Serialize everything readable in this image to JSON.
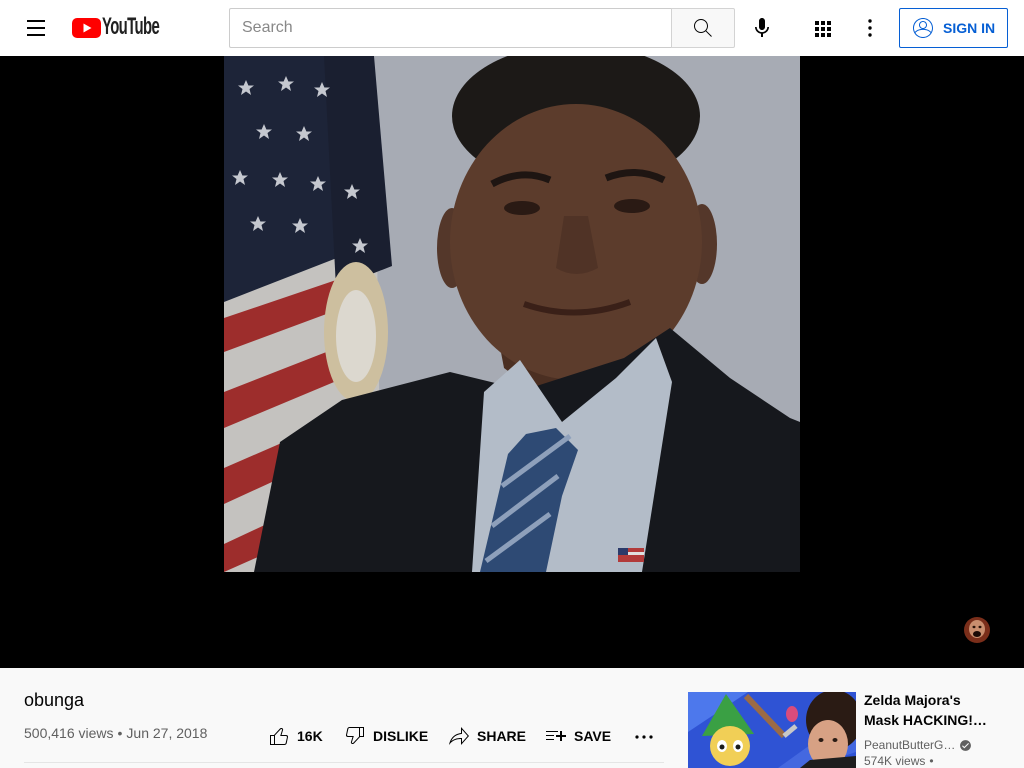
{
  "header": {
    "menu_icon": "hamburger-menu-icon",
    "logo_icon": "youtube-play-icon",
    "logo_text": "YouTube",
    "search_placeholder": "Search",
    "search_icon": "search-icon",
    "mic_icon": "microphone-icon",
    "apps_icon": "apps-grid-icon",
    "more_icon": "more-vertical-icon",
    "sign_in_icon": "account-circle-icon",
    "sign_in_label": "SIGN IN"
  },
  "player": {
    "watermark_icon": "channel-watermark-icon"
  },
  "video": {
    "title": "obunga",
    "views": "500,416 views",
    "separator": "•",
    "date": "Jun 27, 2018"
  },
  "actions": {
    "like_icon": "thumbs-up-icon",
    "like_count": "16K",
    "dislike_icon": "thumbs-down-icon",
    "dislike_label": "DISLIKE",
    "share_icon": "share-icon",
    "share_label": "SHARE",
    "save_icon": "playlist-add-icon",
    "save_label": "SAVE",
    "more_icon": "more-horizontal-icon"
  },
  "recommendations": [
    {
      "title": "Zelda Majora's Mask HACKING!…",
      "channel": "PeanutButterG…",
      "verified_icon": "verified-check-icon",
      "views": "574K views",
      "separator": "•"
    }
  ],
  "colors": {
    "brand_red": "#FF0000",
    "sign_in_blue": "#065FD4",
    "text_primary": "#030303",
    "text_secondary": "#606060",
    "page_bg": "#F9F9F9",
    "player_bg": "#000000"
  }
}
